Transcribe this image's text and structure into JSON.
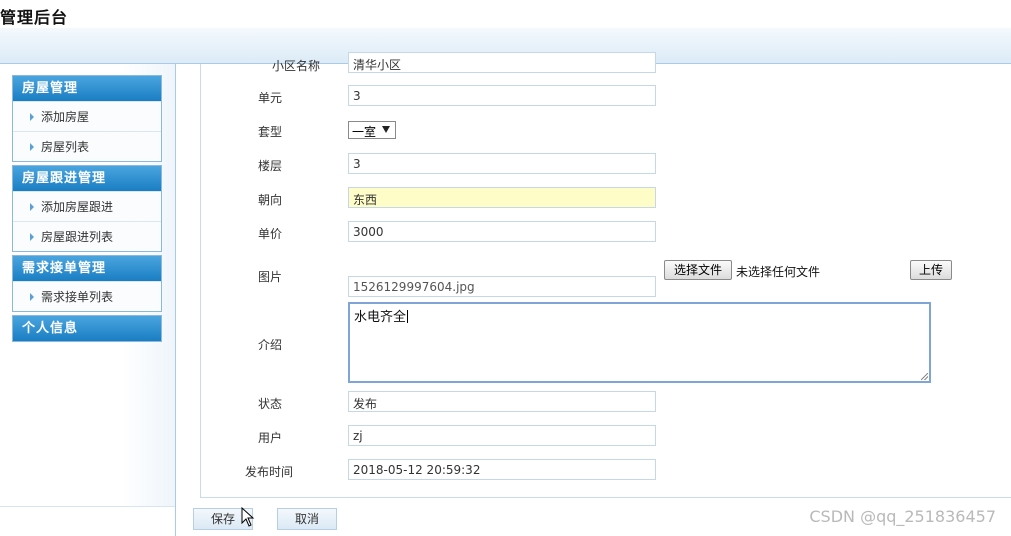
{
  "app": {
    "title": "管理后台"
  },
  "sidebar": {
    "groups": [
      {
        "title": "房屋管理",
        "items": [
          "添加房屋",
          "房屋列表"
        ]
      },
      {
        "title": "房屋跟进管理",
        "items": [
          "添加房屋跟进",
          "房屋跟进列表"
        ]
      },
      {
        "title": "需求接单管理",
        "items": [
          "需求接单列表"
        ]
      },
      {
        "title": "个人信息",
        "items": []
      }
    ]
  },
  "form": {
    "community": {
      "label": "小区名称",
      "value": "清华小区"
    },
    "unit": {
      "label": "单元",
      "value": "3"
    },
    "layout": {
      "label": "套型",
      "value": "一室"
    },
    "floor": {
      "label": "楼层",
      "value": "3"
    },
    "orientation": {
      "label": "朝向",
      "value": "东西"
    },
    "price": {
      "label": "单价",
      "value": "3000"
    },
    "image": {
      "label": "图片",
      "value": "1526129997604.jpg",
      "choose_label": "选择文件",
      "no_file_text": "未选择任何文件",
      "upload_label": "上传"
    },
    "intro": {
      "label": "介绍",
      "value": "水电齐全"
    },
    "status": {
      "label": "状态",
      "value": "发布"
    },
    "user": {
      "label": "用户",
      "value": "zj"
    },
    "publish_time": {
      "label": "发布时间",
      "value": "2018-05-12 20:59:32"
    }
  },
  "actions": {
    "save_label": "保存",
    "cancel_label": "取消"
  },
  "watermark": "CSDN @qq_251836457",
  "colors": {
    "menu_header": "#1a7ec3",
    "highlight_field": "#fefcc7",
    "focus_border": "#7fa5d8"
  }
}
